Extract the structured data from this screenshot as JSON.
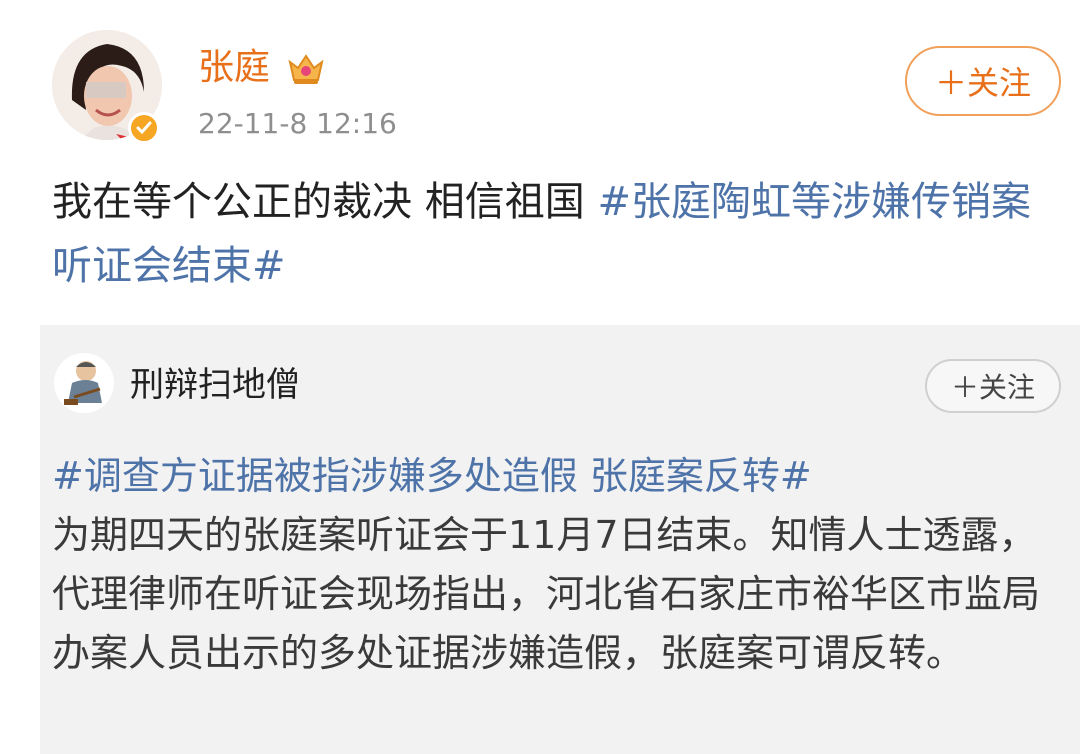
{
  "post": {
    "author_name": "张庭",
    "timestamp": "22-11-8 12:16",
    "follow_label": "＋关注",
    "text": "我在等个公正的裁决 相信祖国 ",
    "hashtag": "#张庭陶虹等涉嫌传销案听证会结束#"
  },
  "repost": {
    "author_name": "刑辩扫地僧",
    "follow_label": "＋关注",
    "hashtag": "#调查方证据被指涉嫌多处造假 张庭案反转#",
    "text": "为期四天的张庭案听证会于11月7日结束。知情人士透露，代理律师在听证会现场指出，河北省石家庄市裕华区市监局办案人员出示的多处证据涉嫌造假，张庭案可谓反转。"
  },
  "colors": {
    "author_name": "#e8701b",
    "hashtag": "#4e73a8",
    "verified_badge": "#f5a623",
    "repost_background": "#f2f2f2"
  },
  "icons": {
    "crown": "crown-icon",
    "verified": "verified-badge-icon"
  }
}
